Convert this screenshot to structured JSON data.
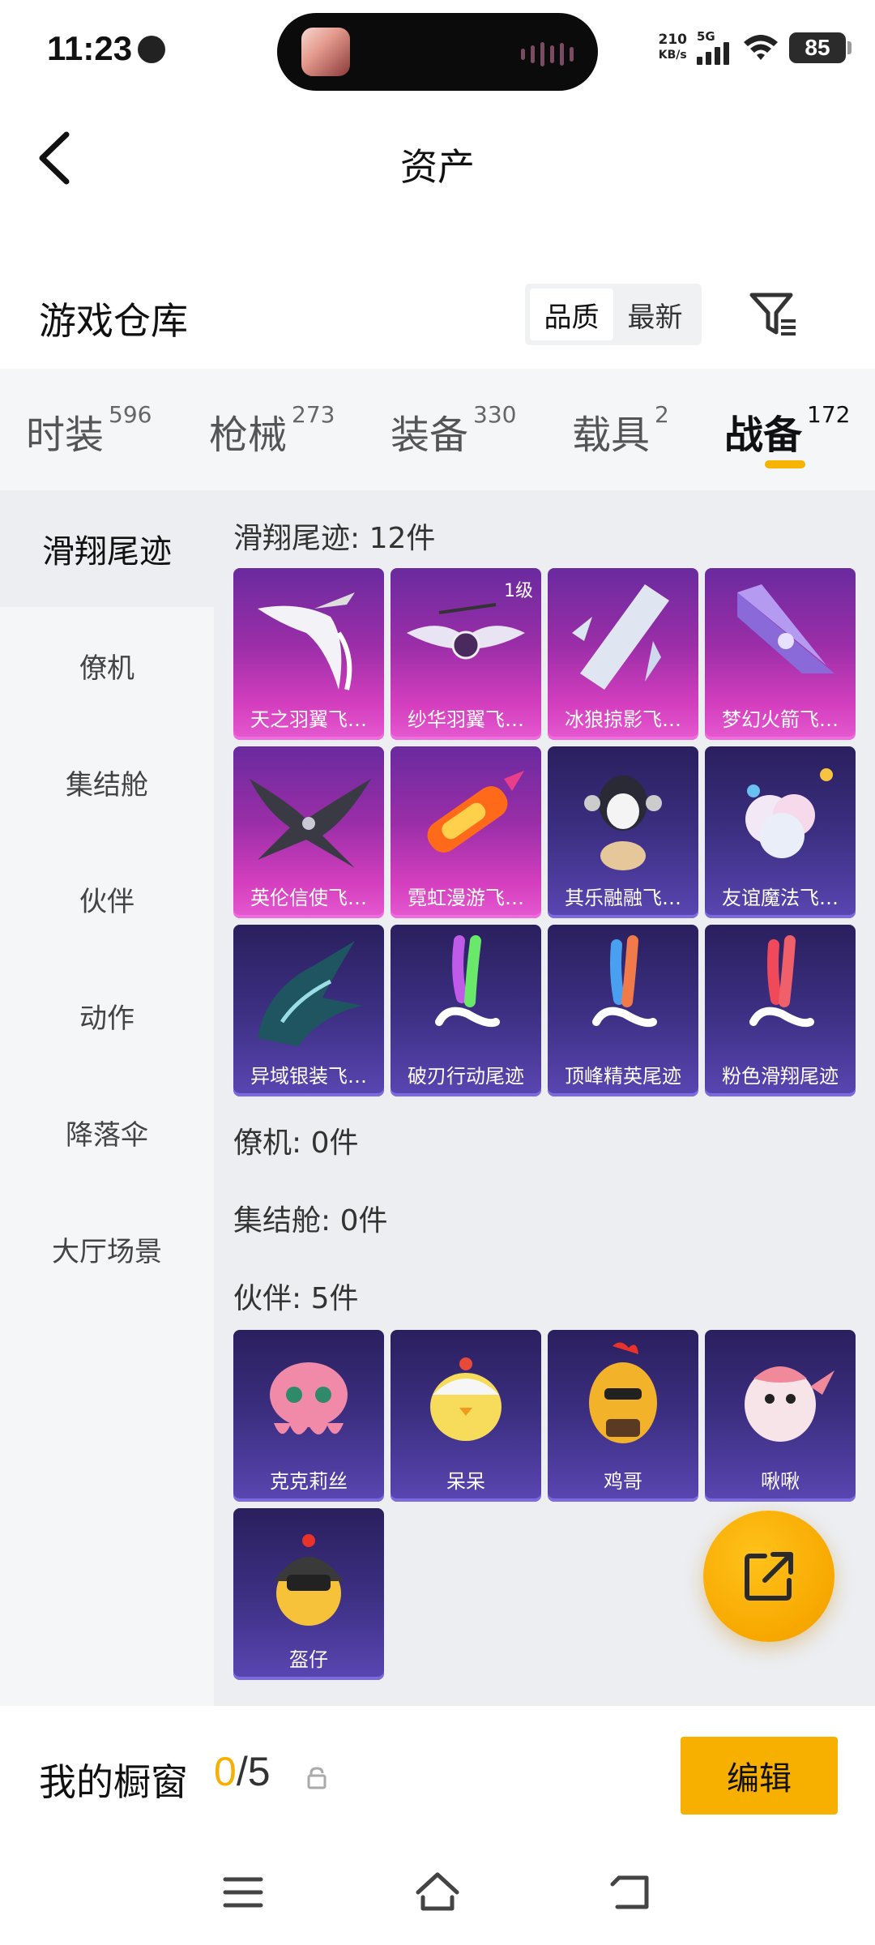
{
  "status": {
    "time": "11:23",
    "net_speed_value": "210",
    "net_speed_unit": "KB/s",
    "network": "5G",
    "battery": "85"
  },
  "header": {
    "title": "资产"
  },
  "warehouse": {
    "title": "游戏仓库",
    "sort_options": [
      "品质",
      "最新"
    ],
    "active_sort": "品质"
  },
  "categories": [
    {
      "name": "时装",
      "count": "596"
    },
    {
      "name": "枪械",
      "count": "273"
    },
    {
      "name": "装备",
      "count": "330"
    },
    {
      "name": "载具",
      "count": "2"
    },
    {
      "name": "战备",
      "count": "172"
    }
  ],
  "active_category": "战备",
  "sidebar": {
    "items": [
      "滑翔尾迹",
      "僚机",
      "集结舱",
      "伙伴",
      "动作",
      "降落伞",
      "大厅场景"
    ],
    "active": "滑翔尾迹"
  },
  "groups": {
    "glide_trails": {
      "title": "滑翔尾迹: 12件",
      "items": [
        {
          "label": "天之羽翼飞…",
          "rarity": "purple"
        },
        {
          "label": "纱华羽翼飞…",
          "rarity": "purple",
          "level": "1级"
        },
        {
          "label": "冰狼掠影飞…",
          "rarity": "purple"
        },
        {
          "label": "梦幻火箭飞…",
          "rarity": "purple"
        },
        {
          "label": "英伦信使飞…",
          "rarity": "purple"
        },
        {
          "label": "霓虹漫游飞…",
          "rarity": "purple"
        },
        {
          "label": "其乐融融飞…",
          "rarity": "blue"
        },
        {
          "label": "友谊魔法飞…",
          "rarity": "blue"
        },
        {
          "label": "异域银装飞…",
          "rarity": "blue"
        },
        {
          "label": "破刃行动尾迹",
          "rarity": "blue"
        },
        {
          "label": "顶峰精英尾迹",
          "rarity": "blue"
        },
        {
          "label": "粉色滑翔尾迹",
          "rarity": "blue"
        }
      ]
    },
    "wingman": {
      "title": "僚机: 0件"
    },
    "capsule": {
      "title": "集结舱: 0件"
    },
    "companion": {
      "title": "伙伴: 5件",
      "items": [
        {
          "label": "克克莉丝",
          "rarity": "blue"
        },
        {
          "label": "呆呆",
          "rarity": "blue"
        },
        {
          "label": "鸡哥",
          "rarity": "blue"
        },
        {
          "label": "啾啾",
          "rarity": "blue"
        },
        {
          "label": "盔仔",
          "rarity": "blue"
        }
      ]
    }
  },
  "showcase": {
    "label": "我的橱窗",
    "current": "0",
    "separator": "/",
    "total": "5",
    "edit_label": "编辑"
  },
  "colors": {
    "accent": "#f7b000",
    "purple_card": "#c13bb8",
    "blue_card": "#3c2f82"
  }
}
